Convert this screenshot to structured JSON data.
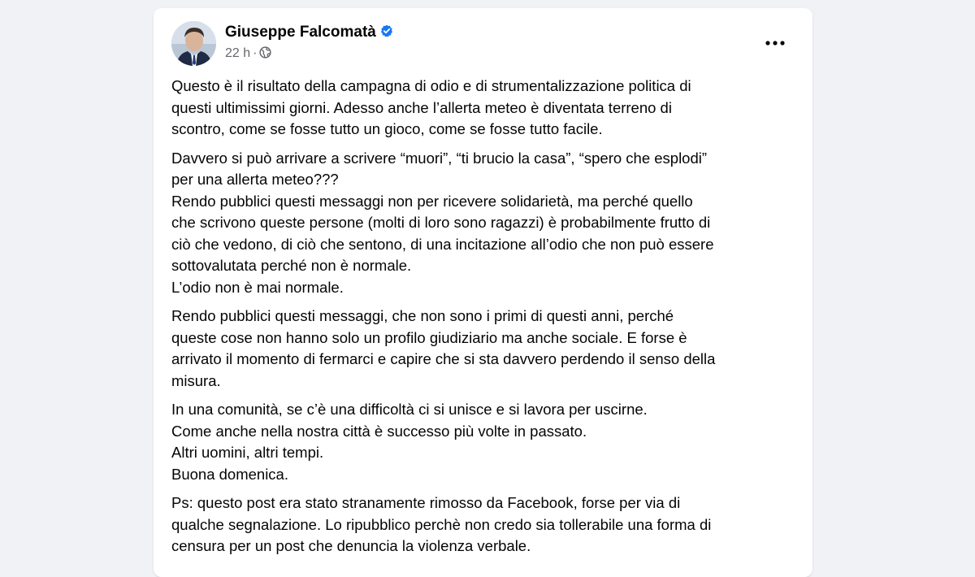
{
  "post": {
    "author": "Giuseppe Falcomatà",
    "time": "22 h",
    "separator": "·",
    "audience_icon": "globe-icon",
    "verified_icon": "verified-badge-icon",
    "more_icon": "more-options-icon",
    "colors": {
      "verified": "#1877f2",
      "secondary_text": "#65676b",
      "background": "#f0f2f5"
    },
    "paragraphs": [
      {
        "lines": [
          "Questo è il risultato della campagna di odio e di strumentalizzazione politica di",
          "questi ultimissimi giorni. Adesso anche l’allerta meteo è diventata terreno di",
          "scontro, come se fosse tutto un gioco, come se fosse tutto facile."
        ]
      },
      {
        "lines": [
          "Davvero si può arrivare a scrivere “muori”, “ti brucio la casa”, “spero che esplodi”",
          "per una allerta meteo???",
          "Rendo pubblici questi messaggi non per ricevere solidarietà, ma perché quello",
          "che scrivono queste persone (molti di loro sono ragazzi) è probabilmente frutto di",
          "ciò che vedono, di ciò che sentono, di una incitazione all’odio che non può essere",
          "sottovalutata perché non è normale.",
          "L’odio non è mai normale."
        ]
      },
      {
        "lines": [
          "Rendo pubblici questi messaggi, che non sono i primi di questi anni, perché",
          "queste cose non hanno solo un profilo giudiziario ma anche sociale. E forse è",
          "arrivato il momento di fermarci e capire che si sta davvero perdendo il senso della",
          "misura."
        ]
      },
      {
        "lines": [
          "In una comunità, se c’è una difficoltà ci si unisce e si lavora per uscirne.",
          "Come anche nella nostra città è successo più volte in passato.",
          "Altri uomini, altri tempi.",
          "Buona domenica."
        ]
      },
      {
        "lines": [
          "Ps: questo post era stato stranamente rimosso da Facebook, forse per via di",
          "qualche segnalazione. Lo ripubblico perchè non credo sia tollerabile una forma di",
          "censura per un post che denuncia la violenza verbale."
        ]
      }
    ]
  }
}
